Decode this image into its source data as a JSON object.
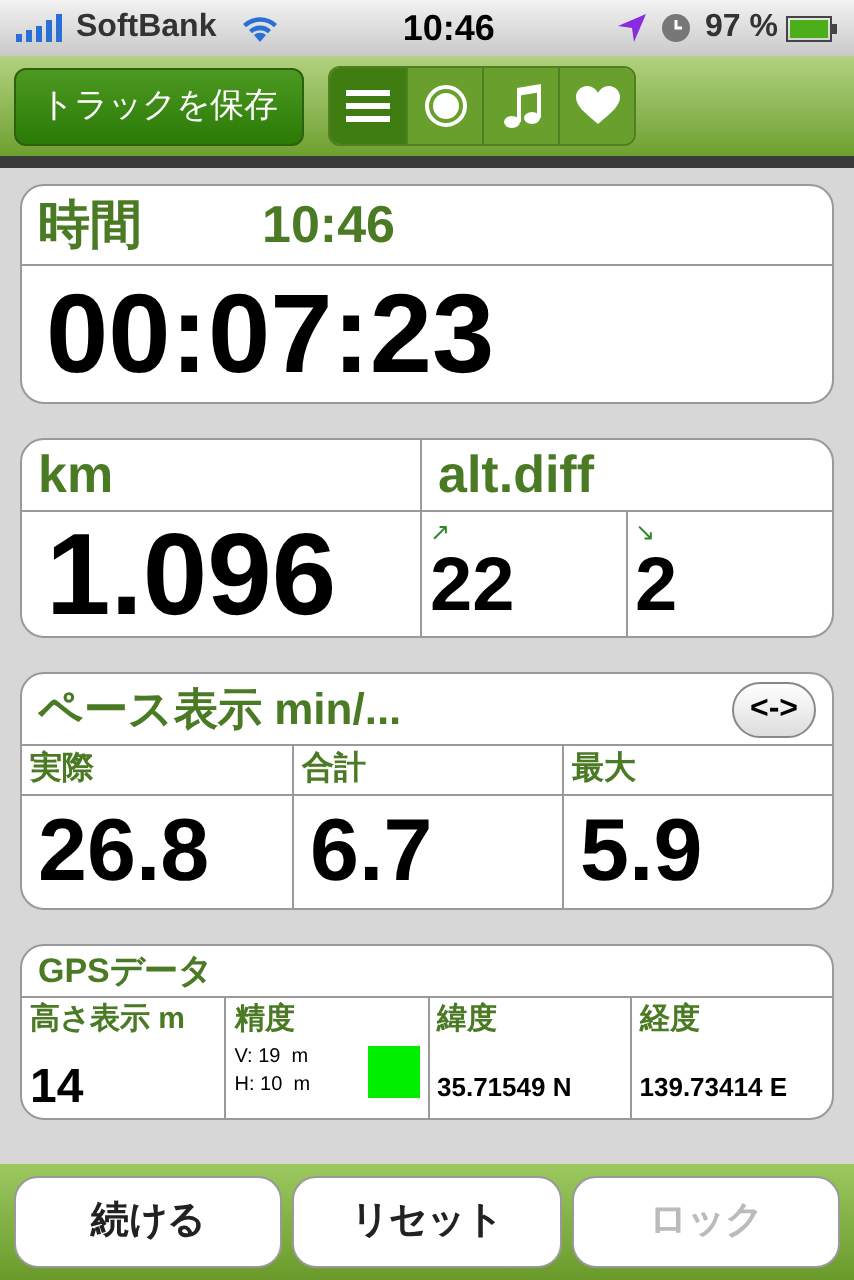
{
  "status_bar": {
    "carrier": "SoftBank",
    "time": "10:46",
    "battery": "97 %"
  },
  "toolbar": {
    "save_button": "トラックを保存",
    "segments": [
      {
        "kind": "list",
        "selected": true
      },
      {
        "kind": "record",
        "selected": false
      },
      {
        "kind": "music",
        "selected": false
      },
      {
        "kind": "heart",
        "selected": false
      }
    ]
  },
  "time_card": {
    "label": "時間",
    "clock": "10:46",
    "elapsed": "00:07:23"
  },
  "distance_card": {
    "label": "km",
    "value": "1.096",
    "alt_label": "alt.diff",
    "up_arrow": "↗",
    "up": "22",
    "down_arrow": "↘",
    "down": "2"
  },
  "pace_card": {
    "title": "ペース表示 min/...",
    "toggle": "<->",
    "cells": [
      {
        "label": "実際",
        "value": "26.8"
      },
      {
        "label": "合計",
        "value": "6.7"
      },
      {
        "label": "最大",
        "value": "5.9"
      }
    ]
  },
  "gps_card": {
    "title": "GPSデータ",
    "altitude_label": "高さ表示 m",
    "altitude": "14",
    "accuracy_label": "精度",
    "vertical": "V: 19  m",
    "horizontal": "H: 10  m",
    "accuracy_indicator": {
      "color": "#00ee00"
    },
    "latitude_label": "緯度",
    "latitude": "35.71549 N",
    "longitude_label": "経度",
    "longitude": "139.73414 E"
  },
  "buttons": [
    {
      "label": "続ける",
      "disabled": false
    },
    {
      "label": "リセット",
      "disabled": false
    },
    {
      "label": "ロック",
      "disabled": true
    }
  ]
}
